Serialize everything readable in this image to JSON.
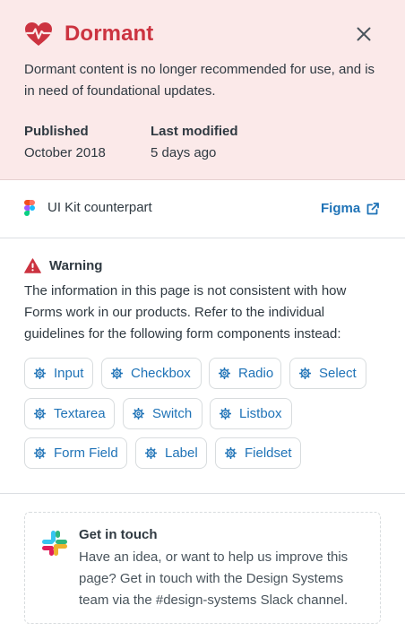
{
  "status": {
    "title": "Dormant",
    "description": "Dormant content is no longer recommended for use, and is in need of foundational updates.",
    "published_label": "Published",
    "published_value": "October 2018",
    "modified_label": "Last modified",
    "modified_value": "5 days ago",
    "icon": "heartbeat-icon",
    "accent_color": "#cc3340",
    "background_color": "#fbe9e9"
  },
  "kit": {
    "label": "UI Kit counterpart",
    "link_label": "Figma",
    "icon": "figma-icon",
    "link_icon": "external-link-icon"
  },
  "warning": {
    "title": "Warning",
    "text": "The information in this page is not consistent with how Forms work in our products. Refer to the individual guidelines for the following form components instead:",
    "icon": "warning-triangle-icon",
    "components": [
      "Input",
      "Checkbox",
      "Radio",
      "Select",
      "Textarea",
      "Switch",
      "Listbox",
      "Form Field",
      "Label",
      "Fieldset"
    ],
    "link_color": "#1f73b7"
  },
  "touch": {
    "title": "Get in touch",
    "text": "Have an idea, or want to help us improve this page? Get in touch with the Design Systems team via the #design-systems Slack channel.",
    "icon": "slack-icon"
  },
  "close": {
    "icon": "close-icon"
  }
}
